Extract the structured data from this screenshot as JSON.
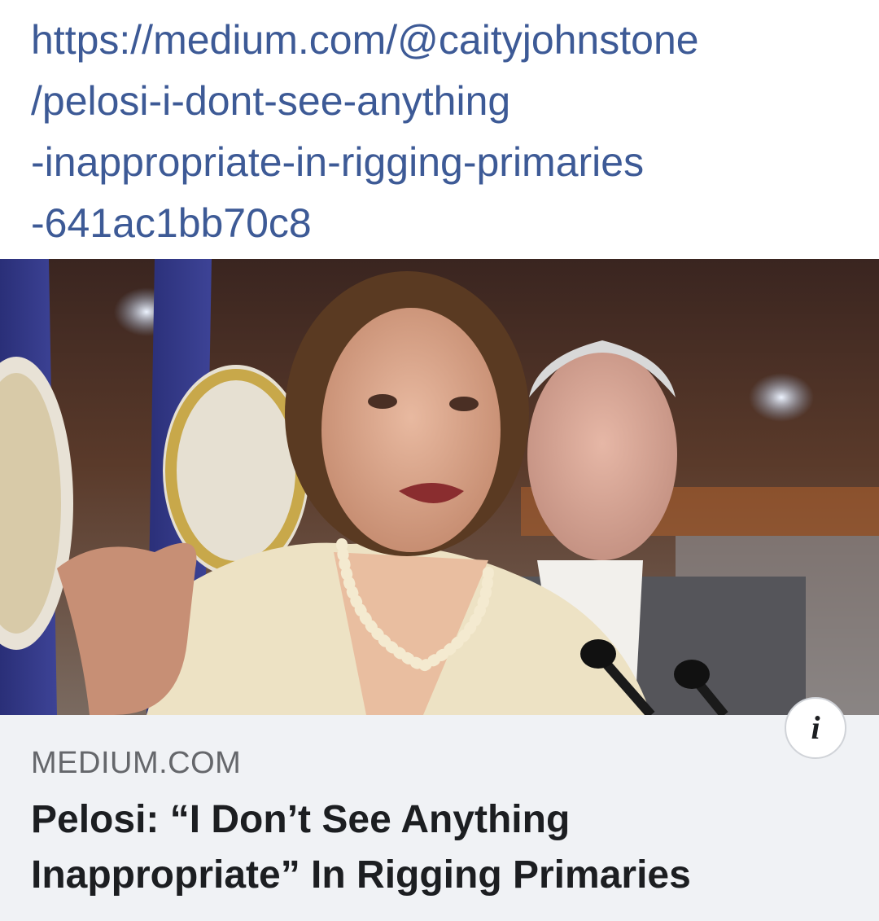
{
  "link": {
    "url_lines": [
      "https://medium.com/@caityjohnstone",
      "/pelosi-i-dont-see-anything",
      "-inappropriate-in-rigging-primaries",
      "-641ac1bb70c8"
    ]
  },
  "preview": {
    "image_alt": "Photo of Nancy Pelosi speaking at a press conference with Steny Hoyer behind her",
    "domain": "MEDIUM.COM",
    "headline_lines": [
      "Pelosi: “I Don’t See Anything",
      "Inappropriate” In Rigging Primaries"
    ],
    "info_icon": "info-icon"
  },
  "colors": {
    "link": "#3d5a96",
    "card_background": "#f0f2f5",
    "headline": "#1c1e21",
    "domain": "#65676b"
  }
}
